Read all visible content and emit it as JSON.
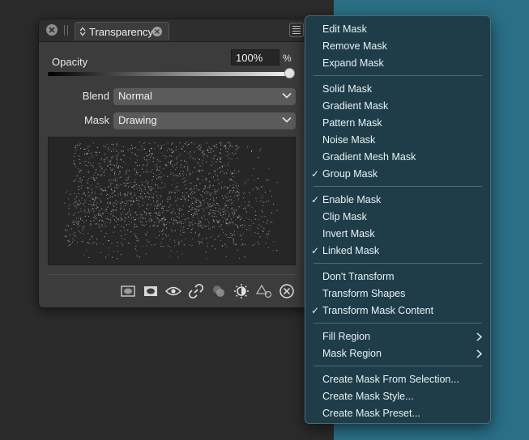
{
  "panel": {
    "tab_title": "Transparency",
    "opacity_label": "Opacity",
    "opacity_value": "100%",
    "opacity_unit": "%",
    "opacity_fraction": 1.0,
    "blend_label": "Blend",
    "blend_value": "Normal",
    "mask_label": "Mask",
    "mask_value": "Drawing",
    "toolbar_icons": [
      "mask-rect-icon",
      "mask-ellipse-icon",
      "eye-icon",
      "link-icon",
      "overlap-circles-icon",
      "brightness-icon",
      "shapes-icon",
      "close-circle-icon"
    ]
  },
  "menu": {
    "groups": [
      [
        {
          "label": "Edit Mask",
          "checked": false,
          "submenu": false
        },
        {
          "label": "Remove Mask",
          "checked": false,
          "submenu": false
        },
        {
          "label": "Expand Mask",
          "checked": false,
          "submenu": false
        }
      ],
      [
        {
          "label": "Solid Mask",
          "checked": false,
          "submenu": false
        },
        {
          "label": "Gradient Mask",
          "checked": false,
          "submenu": false
        },
        {
          "label": "Pattern Mask",
          "checked": false,
          "submenu": false
        },
        {
          "label": "Noise Mask",
          "checked": false,
          "submenu": false
        },
        {
          "label": "Gradient Mesh Mask",
          "checked": false,
          "submenu": false
        },
        {
          "label": "Group Mask",
          "checked": true,
          "submenu": false
        }
      ],
      [
        {
          "label": "Enable Mask",
          "checked": true,
          "submenu": false
        },
        {
          "label": "Clip Mask",
          "checked": false,
          "submenu": false
        },
        {
          "label": "Invert Mask",
          "checked": false,
          "submenu": false
        },
        {
          "label": "Linked Mask",
          "checked": true,
          "submenu": false
        }
      ],
      [
        {
          "label": "Don't Transform",
          "checked": false,
          "submenu": false
        },
        {
          "label": "Transform Shapes",
          "checked": false,
          "submenu": false
        },
        {
          "label": "Transform Mask Content",
          "checked": true,
          "submenu": false
        }
      ],
      [
        {
          "label": "Fill Region",
          "checked": false,
          "submenu": true
        },
        {
          "label": "Mask Region",
          "checked": false,
          "submenu": true
        }
      ],
      [
        {
          "label": "Create Mask From Selection...",
          "checked": false,
          "submenu": false
        },
        {
          "label": "Create Mask Style...",
          "checked": false,
          "submenu": false
        },
        {
          "label": "Create Mask Preset...",
          "checked": false,
          "submenu": false
        }
      ]
    ],
    "check_glyph": "✓"
  },
  "colors": {
    "menu_bg": "#1e3d49",
    "canvas_right": "#2a6f86",
    "panel_bg": "#3c3c3c"
  }
}
